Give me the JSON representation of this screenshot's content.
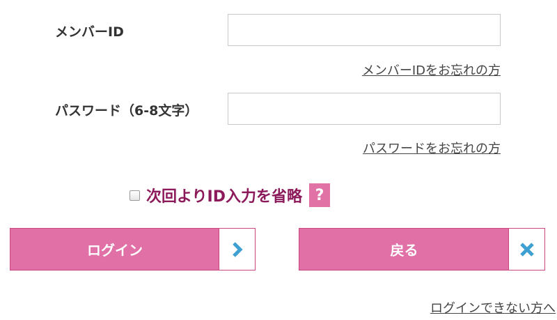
{
  "member_id": {
    "label": "メンバーID",
    "value": "",
    "placeholder": "",
    "forgot_link": "メンバーIDをお忘れの方"
  },
  "password": {
    "label": "パスワード（6-8文字）",
    "value": "",
    "placeholder": "",
    "forgot_link": "パスワードをお忘れの方"
  },
  "remember": {
    "label": "次回よりID入力を省略",
    "checked": false,
    "help_label": "?"
  },
  "buttons": {
    "login_label": "ログイン",
    "login_icon": "chevron-right-icon",
    "back_label": "戻る",
    "back_icon": "close-icon"
  },
  "cant_login_link": "ログインできない方へ",
  "colors": {
    "button_pink": "#e070a5",
    "button_border": "#c9467f",
    "checkbox_label": "#8c1a5a",
    "help_box": "#e072a6",
    "icon_blue": "#3e9fd1"
  }
}
